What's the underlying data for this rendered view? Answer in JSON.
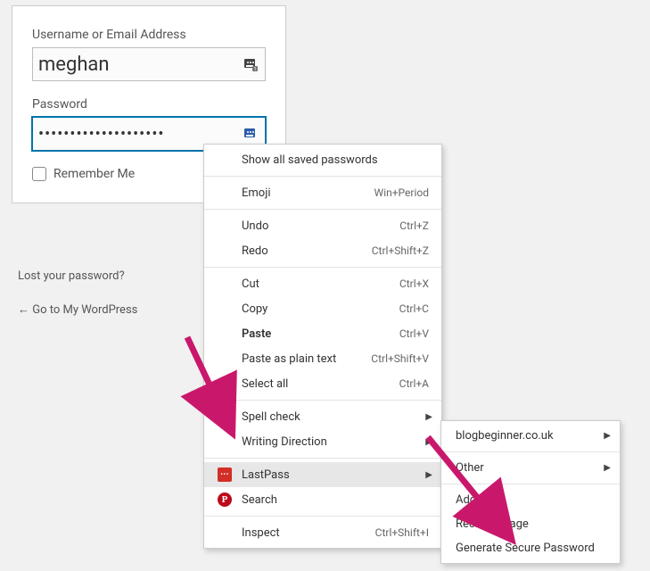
{
  "login": {
    "username_label": "Username or Email Address",
    "username_value": "meghan",
    "password_label": "Password",
    "password_value": "••••••••••••••••••••",
    "remember_label": "Remember Me"
  },
  "links": {
    "lost_password": "Lost your password?",
    "go_back": "← Go to My WordPress"
  },
  "context_menu": {
    "show_all": "Show all saved passwords",
    "emoji": "Emoji",
    "emoji_sc": "Win+Period",
    "undo": "Undo",
    "undo_sc": "Ctrl+Z",
    "redo": "Redo",
    "redo_sc": "Ctrl+Shift+Z",
    "cut": "Cut",
    "cut_sc": "Ctrl+X",
    "copy": "Copy",
    "copy_sc": "Ctrl+C",
    "paste": "Paste",
    "paste_sc": "Ctrl+V",
    "paste_plain": "Paste as plain text",
    "paste_plain_sc": "Ctrl+Shift+V",
    "select_all": "Select all",
    "select_all_sc": "Ctrl+A",
    "spell_check": "Spell check",
    "writing_direction": "Writing Direction",
    "lastpass": "LastPass",
    "search": "Search",
    "inspect": "Inspect",
    "inspect_sc": "Ctrl+Shift+I"
  },
  "submenu": {
    "site": "blogbeginner.co.uk",
    "other": "Other",
    "add_item": "Add Item",
    "recheck": "Recheck Page",
    "generate": "Generate Secure Password"
  }
}
